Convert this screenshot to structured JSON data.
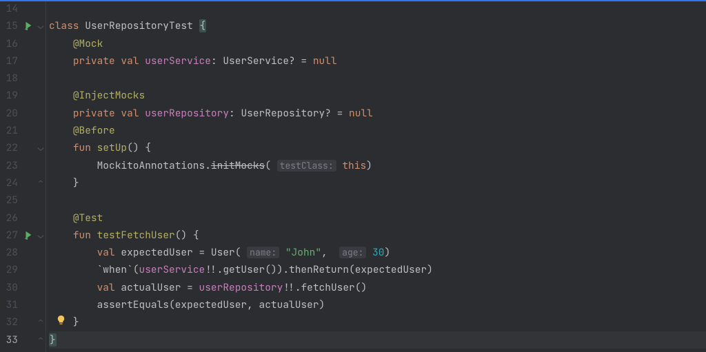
{
  "lines": {
    "start": 14,
    "end": 33,
    "current": 33
  },
  "gutter": {
    "run_icons_at": [
      15,
      27
    ],
    "bulb_at": 32,
    "fold_open_at": [
      15,
      22,
      27
    ],
    "fold_close_at": [
      24,
      32,
      33
    ]
  },
  "code": {
    "l15": {
      "indent": "",
      "kw1": "class ",
      "name": "UserRepositoryTest ",
      "brace": "{"
    },
    "l16": {
      "indent": "    ",
      "ann": "@Mock"
    },
    "l17": {
      "indent": "    ",
      "kw1": "private ",
      "kw2": "val ",
      "field": "userService",
      "rest": ": UserService? = ",
      "null": "null"
    },
    "l19": {
      "indent": "    ",
      "ann": "@InjectMocks"
    },
    "l20": {
      "indent": "    ",
      "kw1": "private ",
      "kw2": "val ",
      "field": "userRepository",
      "rest": ": UserRepository? = ",
      "null": "null"
    },
    "l21": {
      "indent": "    ",
      "ann": "@Before"
    },
    "l22": {
      "indent": "    ",
      "kw1": "fun ",
      "name": "setUp",
      "rest": "() {"
    },
    "l23": {
      "indent": "        ",
      "a": "MockitoAnnotations.",
      "strike": "initMocks",
      "b": "( ",
      "hint": "testClass:",
      "c": " ",
      "kw": "this",
      "d": ")"
    },
    "l24": {
      "indent": "    ",
      "brace": "}"
    },
    "l26": {
      "indent": "    ",
      "ann": "@Test"
    },
    "l27": {
      "indent": "    ",
      "kw1": "fun ",
      "name": "testFetchUser",
      "rest": "() {"
    },
    "l28": {
      "indent": "        ",
      "kw": "val ",
      "var": "expectedUser",
      "a": " = User( ",
      "h1": "name:",
      "s": " \"John\"",
      "b": ",  ",
      "h2": "age:",
      "n": " 30",
      "c": ")"
    },
    "l29": {
      "indent": "        ",
      "a": "`when`(",
      "f": "userService",
      "b": "!!.getUser()).thenReturn(expectedUser)"
    },
    "l30": {
      "indent": "        ",
      "kw": "val ",
      "var": "actualUser",
      "a": " = ",
      "f": "userRepository",
      "b": "!!.fetchUser()"
    },
    "l31": {
      "indent": "        ",
      "fn": "assertEquals",
      "a": "(expectedUser, actualUser)"
    },
    "l32": {
      "indent": "    ",
      "brace": "}"
    },
    "l33": {
      "indent": "",
      "brace": "}"
    }
  }
}
